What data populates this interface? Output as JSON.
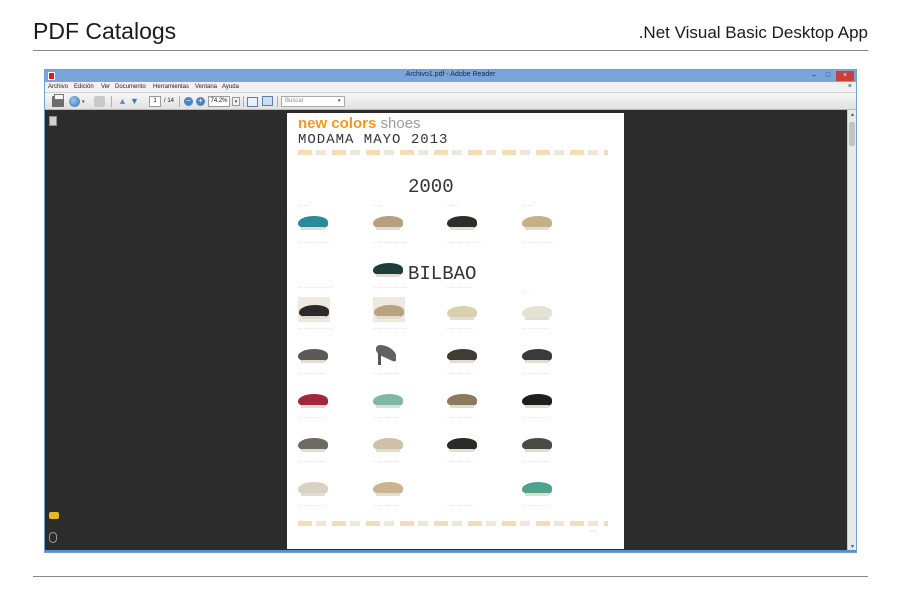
{
  "slide": {
    "title": "PDF Catalogs",
    "subtitle": ".Net Visual Basic Desktop App"
  },
  "window": {
    "title": "Archivo1.pdf - Adobe Reader",
    "menu": [
      "Archivo",
      "Edición",
      "Ver",
      "Documento",
      "Herramientas",
      "Ventana",
      "Ayuda"
    ],
    "close_glyph": "×",
    "min_glyph": "–",
    "max_glyph": "□"
  },
  "toolbar": {
    "current_page": "1",
    "page_total": "/ 14",
    "zoom": "74,2%",
    "search_placeholder": "Buscar"
  },
  "document": {
    "brand": "new colors",
    "brand_suffix": " shoes",
    "title": "MODAMA MAYO 2013",
    "sections": [
      "2000",
      "BILBAO"
    ]
  },
  "colors": {
    "titlebar": "#78a6da",
    "close_button": "#c7403a",
    "brand_orange": "#f39a1e",
    "workspace": "#2c2c2c"
  },
  "icons": [
    "app-icon",
    "print-icon",
    "share-icon",
    "prev-page-icon",
    "next-page-icon",
    "zoom-out-icon",
    "zoom-in-icon",
    "fit-width-icon",
    "fit-page-icon",
    "pages-icon",
    "comment-icon",
    "attachment-icon"
  ]
}
